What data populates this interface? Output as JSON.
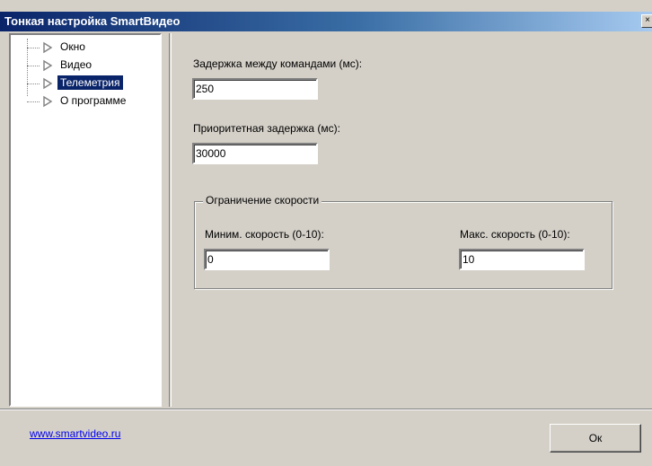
{
  "window": {
    "title": "Тонкая настройка SmartВидео",
    "close_glyph": "×"
  },
  "tree": {
    "items": [
      {
        "label": "Окно",
        "icon": "triangle-right-icon",
        "selected": false
      },
      {
        "label": "Видео",
        "icon": "triangle-right-icon",
        "selected": false
      },
      {
        "label": "Телеметрия",
        "icon": "triangle-right-icon",
        "selected": true
      },
      {
        "label": "О программе",
        "icon": "triangle-right-icon",
        "selected": false
      }
    ]
  },
  "settings": {
    "command_delay": {
      "label": "Задержка между командами (мс):",
      "value": "250"
    },
    "priority_delay": {
      "label": "Приоритетная задержка (мс):",
      "value": "30000"
    },
    "speed_group": {
      "title": "Ограничение скорости",
      "min_speed": {
        "label": "Миним. скорость (0-10):",
        "value": "0"
      },
      "max_speed": {
        "label": "Макс. скорость (0-10):",
        "value": "10"
      }
    }
  },
  "footer": {
    "link_text": "www.smartvideo.ru",
    "ok_label": "Ок"
  },
  "colors": {
    "dialog_bg": "#d4d0c8",
    "title_gradient_start": "#0a246a",
    "title_gradient_end": "#a6caf0",
    "selection_bg": "#0a246a",
    "link": "#0000ee"
  }
}
